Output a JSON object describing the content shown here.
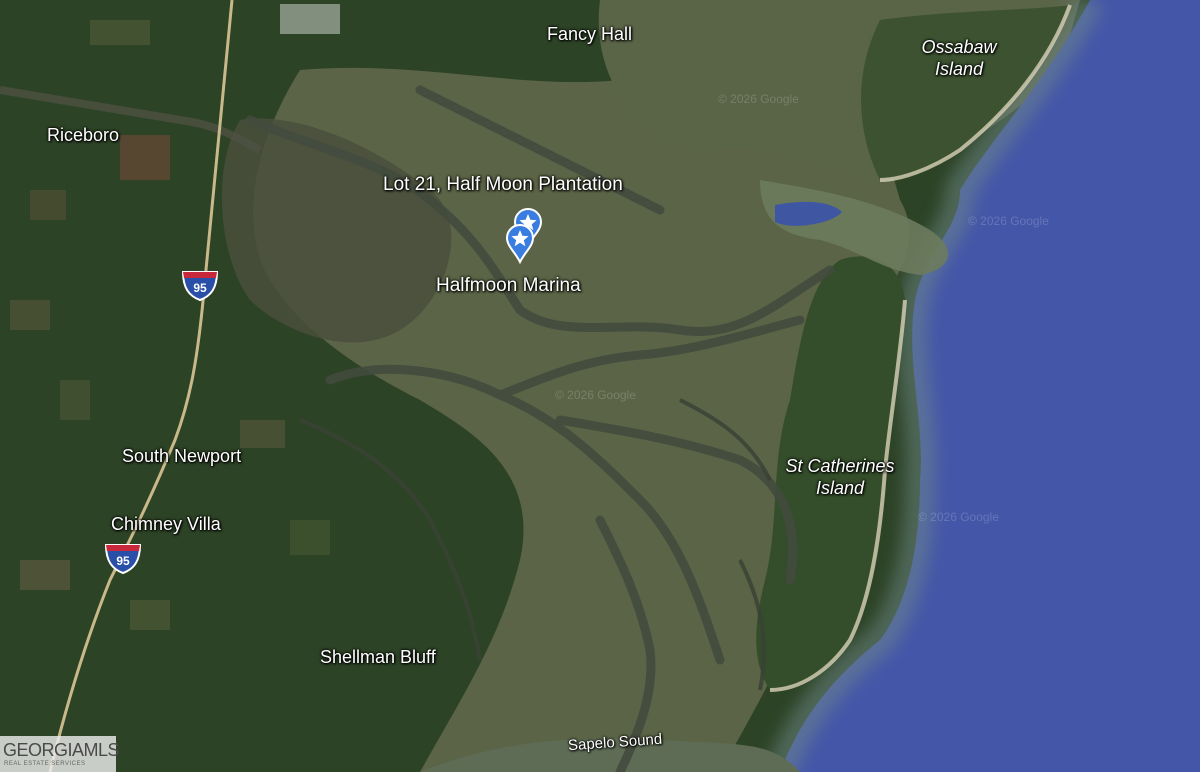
{
  "places": {
    "fancy_hall": "Fancy Hall",
    "ossabaw_island": "Ossabaw Island",
    "riceboro": "Riceboro",
    "lot21": "Lot 21, Half Moon Plantation",
    "halfmoon_marina": "Halfmoon Marina",
    "south_newport": "South Newport",
    "st_catherines_island": "St Catherines Island",
    "chimney_villa": "Chimney Villa",
    "shellman_bluff": "Shellman Bluff",
    "sapelo_sound": "Sapelo Sound"
  },
  "highway": {
    "number": "95"
  },
  "watermark": "© 2026 Google",
  "logo": {
    "text": "GEORGIAMLS",
    "subtext": "REAL ESTATE SERVICES"
  },
  "colors": {
    "ocean": "#4456a8",
    "marsh": "#5b6446",
    "forest": "#2d4326",
    "channel": "#434b3e",
    "pin": "#3a7de0"
  },
  "markers": [
    {
      "name": "Lot 21, Half Moon Plantation",
      "icon": "star-pin-icon"
    },
    {
      "name": "Halfmoon Marina",
      "icon": "star-pin-icon"
    }
  ]
}
